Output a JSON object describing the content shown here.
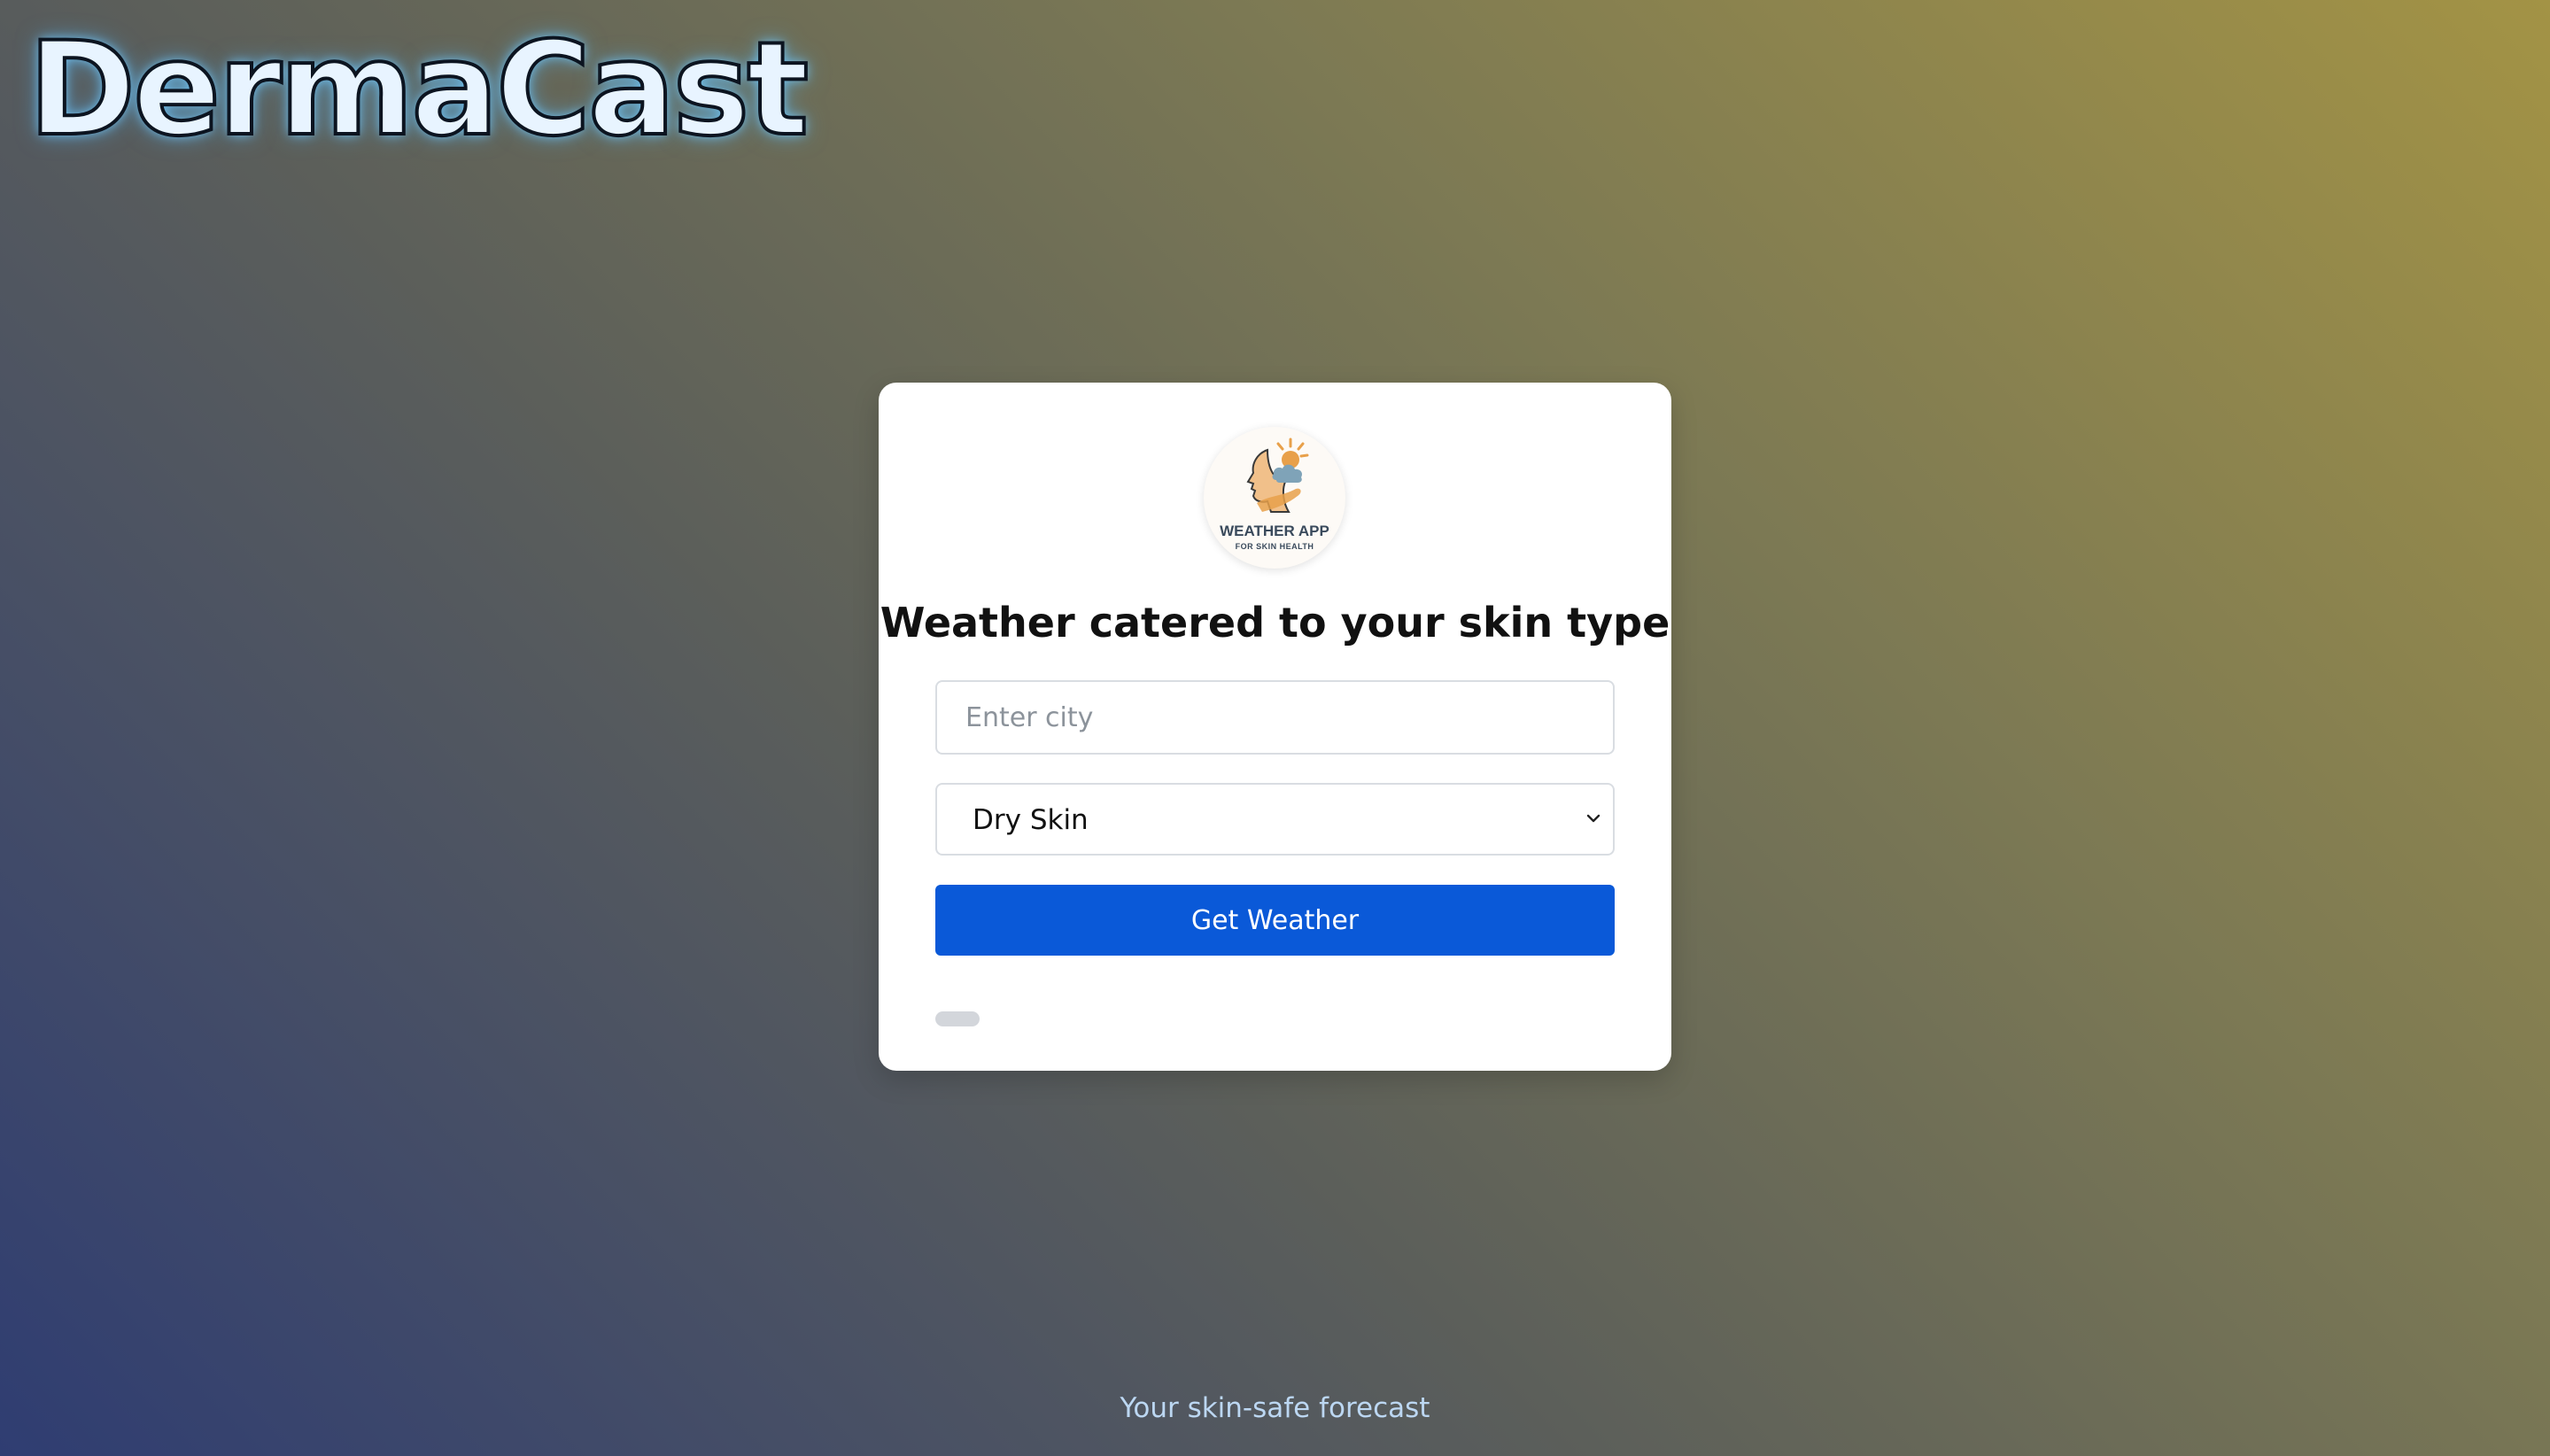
{
  "app": {
    "title": "DermaCast",
    "tagline": "Your skin-safe forecast"
  },
  "card": {
    "logo": {
      "icon": "face-sun-cloud-icon",
      "title": "WEATHER APP",
      "subtitle": "FOR SKIN HEALTH"
    },
    "heading": "Weather catered to your skin type",
    "city_input": {
      "placeholder": "Enter city",
      "value": ""
    },
    "skin_select": {
      "selected": "Dry Skin"
    },
    "submit_label": "Get Weather"
  },
  "colors": {
    "accent": "#0a59d8",
    "brand_glow": "#78cdff",
    "logo_orange": "#e8a04a",
    "logo_cloud": "#7fa3b8"
  }
}
